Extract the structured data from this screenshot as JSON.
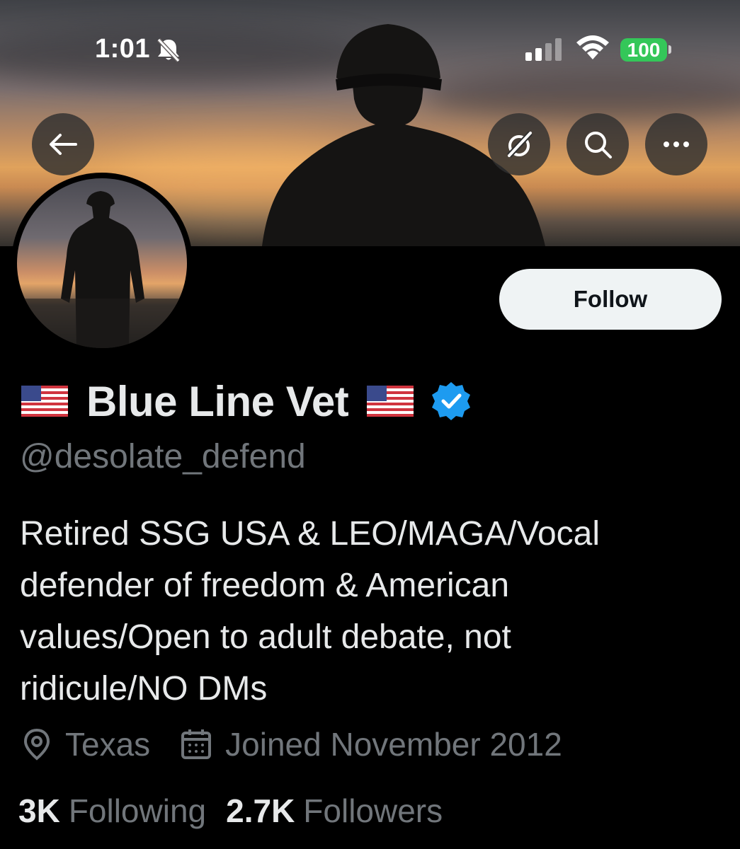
{
  "status_bar": {
    "time": "1:01",
    "battery": "100",
    "icons": [
      "bell-slash-icon",
      "cellular-signal-icon",
      "wifi-icon",
      "battery-icon"
    ]
  },
  "header": {
    "buttons": [
      "back-arrow-icon",
      "grok-icon",
      "search-icon",
      "more-icon"
    ]
  },
  "profile": {
    "flag_left": "🇺🇸",
    "display_name": "Blue Line Vet",
    "flag_right": "🇺🇸",
    "handle": "@desolate_defend",
    "verified": true,
    "follow_label": "Follow",
    "bio_lines": [
      "Retired SSG USA & LEO/MAGA/Vocal",
      "defender of freedom & American",
      "values/Open to adult debate, not",
      "ridicule/NO DMs"
    ],
    "location": "Texas",
    "joined": "Joined November 2012",
    "following_count": "3K",
    "following_label": "Following",
    "followers_count": "2.7K",
    "followers_label": "Followers"
  },
  "colors": {
    "background": "#000000",
    "text_primary": "#e7e9ea",
    "text_secondary": "#71767b",
    "verified_blue": "#1d9bf0",
    "battery_green": "#34c759",
    "follow_bg": "#eff3f4"
  }
}
